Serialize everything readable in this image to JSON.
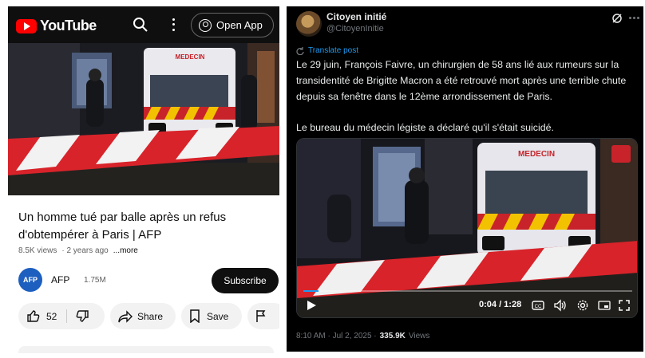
{
  "youtube": {
    "logo_text": "YouTube",
    "open_app_label": "Open App",
    "video_title": "Un homme tué par balle après un refus d'obtempérer à Paris | AFP",
    "views": "8.5K views",
    "age": "· 2 years ago",
    "more_label": "...more",
    "channel": {
      "avatar_text": "AFP",
      "name": "AFP",
      "subscribers": "1.75M",
      "subscribe_label": "Subscribe"
    },
    "actions": {
      "like_count": "52",
      "share_label": "Share",
      "save_label": "Save"
    },
    "ambulance_text": "MEDECIN",
    "icons": [
      "search-icon",
      "more-vert-icon",
      "account-icon",
      "like-icon",
      "dislike-icon",
      "share-icon",
      "save-icon",
      "report-icon"
    ]
  },
  "tweet": {
    "display_name": "Citoyen initié",
    "handle": "@CitoyenInitie",
    "translate_label": "Translate post",
    "paragraph_1": "Le 29 juin, François Faivre, un chirurgien de 58 ans lié aux rumeurs sur la transidentité de Brigitte Macron a été retrouvé mort après une terrible chute depuis sa fenêtre dans le 12ème arrondissement de Paris.",
    "paragraph_2": "Le bureau du médecin légiste a déclaré qu'il s'était suicidé.",
    "video": {
      "time": "0:04 / 1:28",
      "ambulance_text": "MEDECIN",
      "watch_progress": 0.045
    },
    "timestamp": "8:10 AM · Jul 2, 2025 ·",
    "views_count": "335.9K",
    "views_label": "Views",
    "icons": [
      "grok-icon",
      "more-horiz-icon",
      "translate-icon",
      "play-icon",
      "cc-icon",
      "volume-icon",
      "settings-icon",
      "pip-icon",
      "fullscreen-icon"
    ]
  },
  "colors": {
    "youtube_red": "#ff0000",
    "twitter_blue": "#1d9bf0",
    "tape_red": "#d8232a",
    "ambulance_yellow": "#f2c200"
  }
}
